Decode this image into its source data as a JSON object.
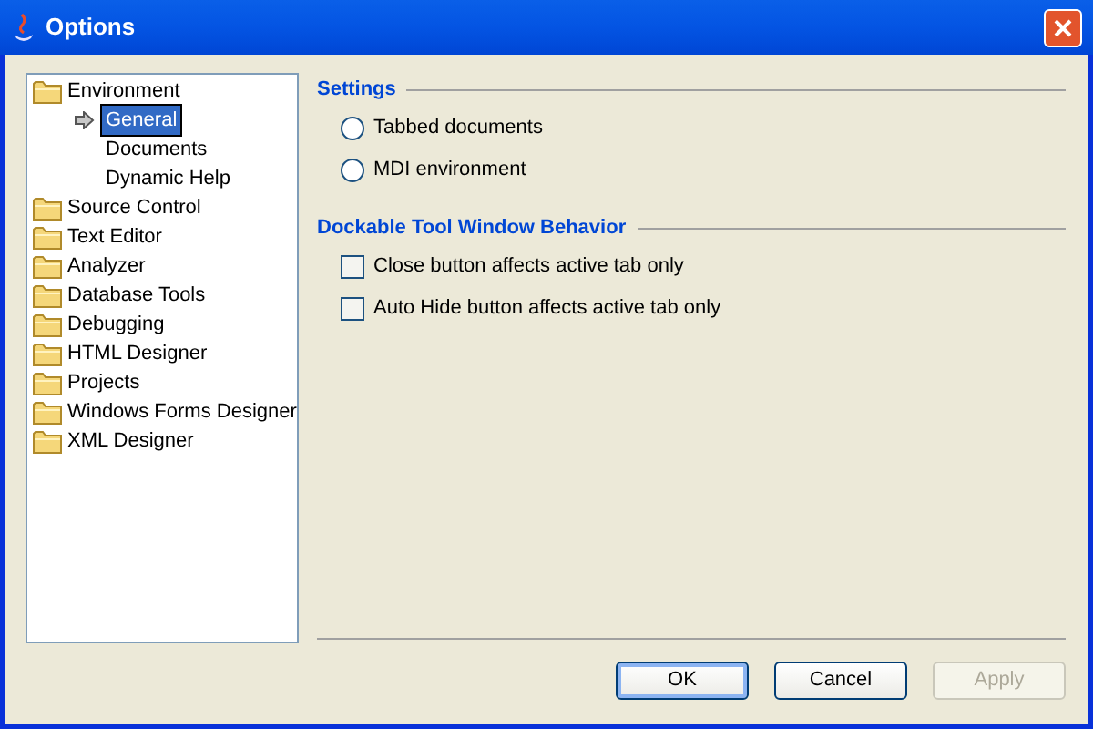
{
  "window": {
    "title": "Options"
  },
  "tree": [
    {
      "label": "Environment",
      "expanded": true,
      "children": [
        {
          "label": "General",
          "selected": true
        },
        {
          "label": "Documents",
          "selected": false
        },
        {
          "label": "Dynamic Help",
          "selected": false
        }
      ]
    },
    {
      "label": "Source Control"
    },
    {
      "label": "Text Editor"
    },
    {
      "label": "Analyzer"
    },
    {
      "label": "Database Tools"
    },
    {
      "label": "Debugging"
    },
    {
      "label": "HTML Designer"
    },
    {
      "label": "Projects"
    },
    {
      "label": "Windows Forms Designer"
    },
    {
      "label": "XML Designer"
    }
  ],
  "sections": [
    {
      "title": "Settings",
      "options": [
        {
          "kind": "radio",
          "label": "Tabbed documents",
          "checked": false
        },
        {
          "kind": "radio",
          "label": "MDI environment",
          "checked": false
        }
      ]
    },
    {
      "title": "Dockable Tool Window Behavior",
      "options": [
        {
          "kind": "checkbox",
          "label": "Close button affects active tab only",
          "checked": false
        },
        {
          "kind": "checkbox",
          "label": "Auto Hide button affects active tab only",
          "checked": false
        }
      ]
    }
  ],
  "buttons": [
    {
      "label": "OK",
      "disabled": false,
      "default": true
    },
    {
      "label": "Cancel",
      "disabled": false,
      "default": false
    },
    {
      "label": "Apply",
      "disabled": true,
      "default": false
    }
  ]
}
